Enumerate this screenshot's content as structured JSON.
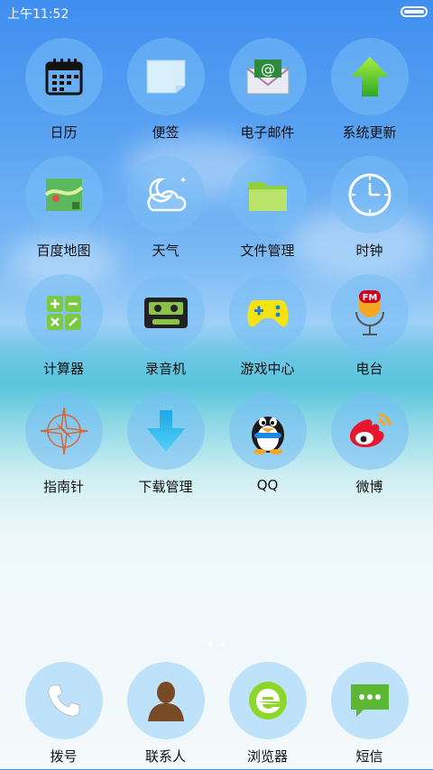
{
  "status_bar": {
    "time": "上午11:52"
  },
  "apps": [
    {
      "id": "calendar",
      "label": "日历",
      "icon": "calendar-icon"
    },
    {
      "id": "notes",
      "label": "便签",
      "icon": "notes-icon"
    },
    {
      "id": "email",
      "label": "电子邮件",
      "icon": "email-icon"
    },
    {
      "id": "system-update",
      "label": "系统更新",
      "icon": "update-arrow-icon"
    },
    {
      "id": "baidu-map",
      "label": "百度地图",
      "icon": "map-icon"
    },
    {
      "id": "weather",
      "label": "天气",
      "icon": "weather-icon"
    },
    {
      "id": "file-manager",
      "label": "文件管理",
      "icon": "folder-icon"
    },
    {
      "id": "clock",
      "label": "时钟",
      "icon": "clock-icon"
    },
    {
      "id": "calculator",
      "label": "计算器",
      "icon": "calculator-icon"
    },
    {
      "id": "recorder",
      "label": "录音机",
      "icon": "cassette-icon"
    },
    {
      "id": "game-center",
      "label": "游戏中心",
      "icon": "gamepad-icon"
    },
    {
      "id": "radio",
      "label": "电台",
      "icon": "fm-microphone-icon"
    },
    {
      "id": "compass",
      "label": "指南针",
      "icon": "compass-icon"
    },
    {
      "id": "download-manager",
      "label": "下载管理",
      "icon": "download-icon"
    },
    {
      "id": "qq",
      "label": "QQ",
      "icon": "penguin-icon"
    },
    {
      "id": "weibo",
      "label": "微博",
      "icon": "weibo-icon"
    }
  ],
  "dock": [
    {
      "id": "phone",
      "label": "拨号",
      "icon": "phone-icon"
    },
    {
      "id": "contacts",
      "label": "联系人",
      "icon": "contact-person-icon"
    },
    {
      "id": "browser",
      "label": "浏览器",
      "icon": "browser-e-icon"
    },
    {
      "id": "messages",
      "label": "短信",
      "icon": "message-bubble-icon"
    }
  ],
  "icon_text": {
    "email_at": "@",
    "fm": "FM"
  }
}
